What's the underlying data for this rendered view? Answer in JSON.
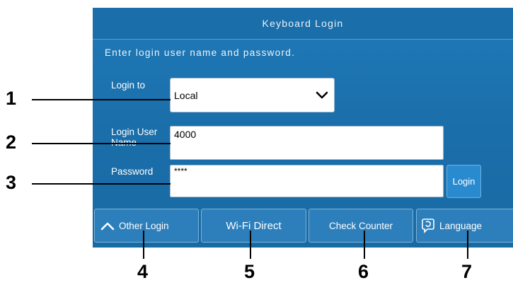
{
  "header": {
    "title": "Keyboard Login"
  },
  "instruction": "Enter login user name and password.",
  "form": {
    "login_to": {
      "label": "Login to",
      "value": "Local"
    },
    "user_name": {
      "label": "Login User Name",
      "value": "4000"
    },
    "password": {
      "label": "Password",
      "value": "****"
    },
    "login_button": "Login"
  },
  "bottom_bar": {
    "other_login": "Other Login",
    "wifi_direct": "Wi-Fi Direct",
    "check_counter": "Check Counter",
    "language": "Language"
  },
  "callouts": {
    "c1": "1",
    "c2": "2",
    "c3": "3",
    "c4": "4",
    "c5": "5",
    "c6": "6",
    "c7": "7"
  },
  "icons": {
    "select_arrow": "chevron-down-icon",
    "other_login": "chevron-up-icon",
    "language": "language-speech-bubble-icon"
  }
}
